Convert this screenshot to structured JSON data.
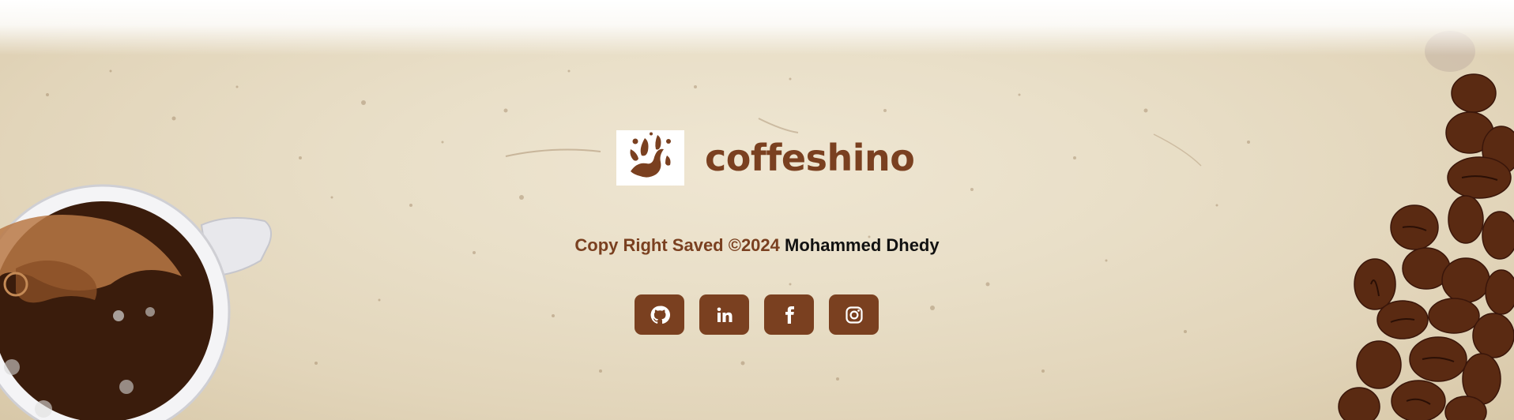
{
  "brand": {
    "name": "coffeshino",
    "logo_icon": "coffee-splash-icon"
  },
  "footer": {
    "copyright_prefix": "Copy Right Saved ©2024",
    "copyright_author": "Mohammed Dhedy"
  },
  "socials": [
    {
      "name": "GitHub",
      "icon": "github-icon"
    },
    {
      "name": "LinkedIn",
      "icon": "linkedin-icon"
    },
    {
      "name": "Facebook",
      "icon": "facebook-icon"
    },
    {
      "name": "Instagram",
      "icon": "instagram-icon"
    }
  ],
  "colors": {
    "brand_brown": "#7a4020",
    "background": "#e9dfc8",
    "author_text": "#111111"
  }
}
